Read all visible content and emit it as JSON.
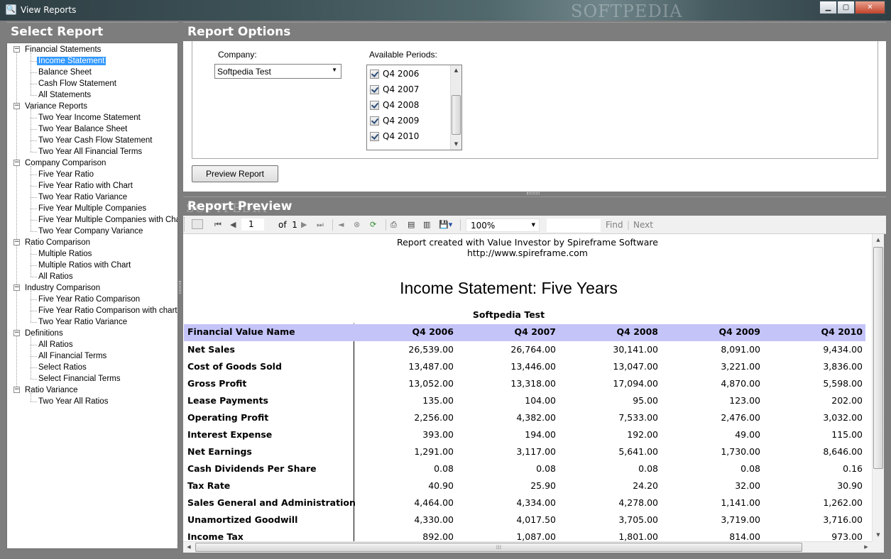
{
  "window": {
    "title": "View Reports",
    "watermark": "SOFTPEDIA"
  },
  "left_panel": {
    "title": "Select Report"
  },
  "tree": [
    {
      "label": "Financial Statements",
      "children": [
        "Income Statement",
        "Balance Sheet",
        "Cash Flow Statement",
        "All Statements"
      ]
    },
    {
      "label": "Variance Reports",
      "children": [
        "Two Year Income Statement",
        "Two Year Balance Sheet",
        "Two Year Cash Flow Statement",
        "Two Year All Financial Terms"
      ]
    },
    {
      "label": "Company Comparison",
      "children": [
        "Five Year Ratio",
        "Five Year Ratio with Chart",
        "Two Year Ratio Variance",
        "Five Year Multiple Companies",
        "Five Year Multiple Companies with Chart",
        "Two Year Company Variance"
      ]
    },
    {
      "label": "Ratio Comparison",
      "children": [
        "Multiple Ratios",
        "Multiple Ratios with Chart",
        "All Ratios"
      ]
    },
    {
      "label": "Industry Comparison",
      "children": [
        "Five Year Ratio Comparison",
        "Five Year Ratio Comparison with chart",
        "Two Year Ratio Variance"
      ]
    },
    {
      "label": "Definitions",
      "children": [
        "All Ratios",
        "All Financial Terms",
        "Select Ratios",
        "Select Financial Terms"
      ]
    },
    {
      "label": "Ratio Variance",
      "children": [
        "Two Year All Ratios"
      ]
    }
  ],
  "selected_item": "Income Statement",
  "options_panel": {
    "title": "Report Options",
    "company_label": "Company:",
    "company_value": "Softpedia Test",
    "periods_label": "Available Periods:",
    "periods": [
      "Q4 2006",
      "Q4 2007",
      "Q4 2008",
      "Q4 2009",
      "Q4 2010"
    ],
    "preview_button": "Preview Report"
  },
  "preview_panel": {
    "title": "Report Preview",
    "watermark": "SOFTPEDIA"
  },
  "toolbar": {
    "page_current": "1",
    "page_of": "of",
    "page_total": "1",
    "zoom": "100%",
    "find_label": "Find",
    "separator": "|",
    "next_label": "Next"
  },
  "report": {
    "credit_line": "Report created with Value Investor by Spireframe Software",
    "credit_url": "http://www.spireframe.com",
    "title": "Income Statement: Five Years",
    "company": "Softpedia Test",
    "columns": [
      "Financial Value Name",
      "Q4 2006",
      "Q4 2007",
      "Q4 2008",
      "Q4 2009",
      "Q4 2010"
    ],
    "rows": [
      [
        "Net Sales",
        "26,539.00",
        "26,764.00",
        "30,141.00",
        "8,091.00",
        "9,434.00"
      ],
      [
        "Cost of Goods Sold",
        "13,487.00",
        "13,446.00",
        "13,047.00",
        "3,221.00",
        "3,836.00"
      ],
      [
        "Gross Profit",
        "13,052.00",
        "13,318.00",
        "17,094.00",
        "4,870.00",
        "5,598.00"
      ],
      [
        "Lease Payments",
        "135.00",
        "104.00",
        "95.00",
        "123.00",
        "202.00"
      ],
      [
        "Operating Profit",
        "2,256.00",
        "4,382.00",
        "7,533.00",
        "2,476.00",
        "3,032.00"
      ],
      [
        "Interest Expense",
        "393.00",
        "194.00",
        "192.00",
        "49.00",
        "115.00"
      ],
      [
        "Net Earnings",
        "1,291.00",
        "3,117.00",
        "5,641.00",
        "1,730.00",
        "8,646.00"
      ],
      [
        "Cash Dividends Per Share",
        "0.08",
        "0.08",
        "0.08",
        "0.08",
        "0.16"
      ],
      [
        "Tax Rate",
        "40.90",
        "25.90",
        "24.20",
        "32.00",
        "30.90"
      ],
      [
        "Sales General and Administration",
        "4,464.00",
        "4,334.00",
        "4,278.00",
        "1,141.00",
        "1,262.00"
      ],
      [
        "Unamortized Goodwill",
        "4,330.00",
        "4,017.50",
        "3,705.00",
        "3,719.00",
        "3,716.00"
      ],
      [
        "Income Tax",
        "892.00",
        "1,087.00",
        "1,801.00",
        "814.00",
        "973.00"
      ]
    ]
  }
}
